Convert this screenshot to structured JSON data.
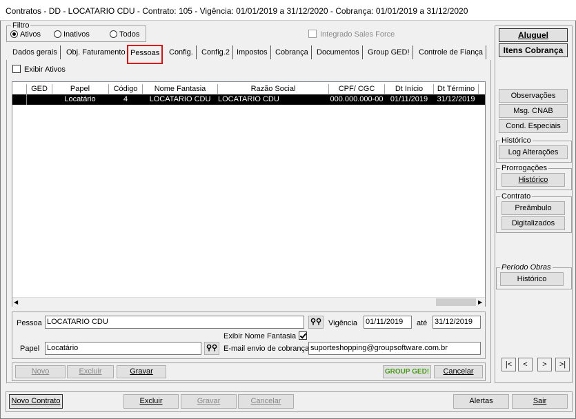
{
  "window": {
    "title": "Contratos - DD - LOCATARIO CDU - Contrato: 105 - Vigência: 01/01/2019 a 31/12/2020 - Cobrança: 01/01/2019 a 31/12/2020"
  },
  "filter": {
    "group_label": "Filtro",
    "options": [
      "Ativos",
      "Inativos",
      "Todos"
    ],
    "selected": "Ativos",
    "integrado_label": "Integrado Sales Force"
  },
  "tabs": [
    "Dados gerais",
    "Obj. Faturamento",
    "Pessoas",
    "Config.",
    "Config.2",
    "Impostos",
    "Cobrança",
    "Documentos",
    "Group GED!",
    "Controle de Fiança"
  ],
  "active_tab": "Pessoas",
  "exibir_ativos_label": "Exibir Ativos",
  "table": {
    "columns": [
      "GED",
      "Papel",
      "Código",
      "Nome Fantasia",
      "Razão Social",
      "CPF/ CGC",
      "Dt Início",
      "Dt Término"
    ],
    "rows": [
      {
        "ged": "",
        "papel": "Locatário",
        "codigo": "4",
        "nome_fantasia": "LOCATARIO CDU",
        "razao_social": "LOCATARIO CDU",
        "cpf_cgc": "000.000.000-00",
        "dt_inicio": "01/11/2019",
        "dt_termino": "31/12/2019"
      }
    ]
  },
  "form": {
    "pessoa_label": "Pessoa",
    "pessoa_value": "LOCATARIO CDU",
    "vigencia_label": "Vigência",
    "vigencia_start": "01/11/2019",
    "ate_label": "até",
    "vigencia_end": "31/12/2019",
    "exibir_nome_fantasia_label": "Exibir Nome Fantasia",
    "papel_label": "Papel",
    "papel_value": "Locatário",
    "email_label": "E-mail envio de cobrança",
    "email_value": "suporteshopping@groupsoftware.com.br"
  },
  "inner_buttons": {
    "novo": "Novo",
    "excluir": "Excluir",
    "gravar": "Gravar",
    "group_ged": "GROUP GED!",
    "cancelar": "Cancelar"
  },
  "side_panel": {
    "aluguel": "Aluguel",
    "itens_cobranca": "Itens Cobrança",
    "observacoes": "Observações",
    "msg_cnab": "Msg. CNAB",
    "cond_especiais": "Cond. Especiais",
    "historico_group": "Histórico",
    "log_alteracoes": "Log Alterações",
    "prorrogacoes_group": "Prorrogações",
    "prorrogacoes_historico": "Histórico",
    "contrato_group": "Contrato",
    "preambulo": "Preâmbulo",
    "digitalizados": "Digitalizados",
    "periodo_obras_group": "Período Obras",
    "periodo_obras_historico": "Histórico",
    "nav": [
      "|<",
      "<",
      ">",
      ">|"
    ]
  },
  "bottom_buttons": {
    "novo_contrato": "Novo Contrato",
    "excluir": "Excluir",
    "gravar": "Gravar",
    "cancelar": "Cancelar",
    "alertas": "Alertas",
    "sair": "Sair"
  }
}
